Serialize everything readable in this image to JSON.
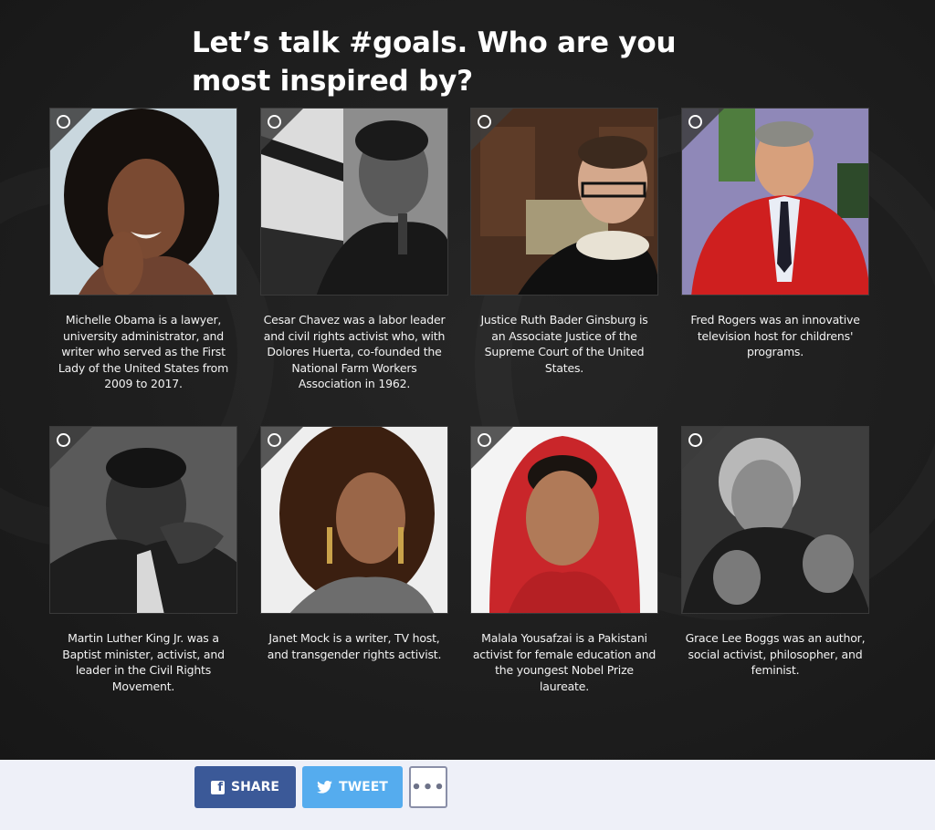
{
  "quiz": {
    "question": "Let’s talk #goals. Who are you most inspired by?",
    "options": [
      {
        "caption": "Michelle Obama is a lawyer, university administrator, and writer who served as the First Lady of the United States from 2009 to 2017."
      },
      {
        "caption": "Cesar Chavez was a labor leader and civil rights activist who, with Dolores Huerta, co-founded the National Farm Workers Association in 1962."
      },
      {
        "caption": "Justice Ruth Bader Ginsburg is an Associate Justice of the Supreme Court of the United States."
      },
      {
        "caption": "Fred Rogers was an innovative television host for childrens' programs."
      },
      {
        "caption": "Martin Luther King Jr. was a Baptist minister, activist, and leader in the Civil Rights Movement."
      },
      {
        "caption": "Janet Mock is a writer, TV host, and transgender rights activist."
      },
      {
        "caption": "Malala Yousafzai is a Pakistani activist for female education and the youngest Nobel Prize laureate."
      },
      {
        "caption": "Grace Lee Boggs was an author, social activist, philosopher, and feminist."
      }
    ]
  },
  "share": {
    "share_label": "SHARE",
    "tweet_label": "TWEET",
    "more_label": "•••",
    "facebook_icon": "f"
  },
  "colors": {
    "facebook": "#3b5998",
    "twitter": "#55acee",
    "background": "#1e1e1e"
  }
}
